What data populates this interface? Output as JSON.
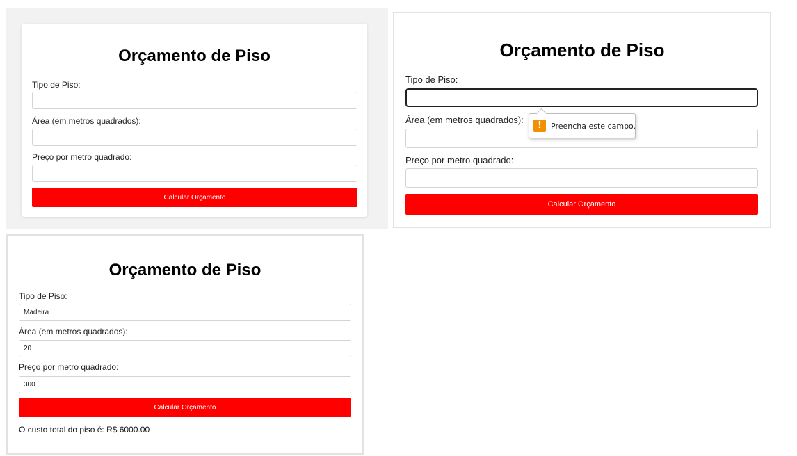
{
  "screens": {
    "initial": {
      "title": "Orçamento de Piso",
      "tipo_label": "Tipo de Piso:",
      "area_label": "Área (em metros quadrados):",
      "preco_label": "Preço por metro quadrado:",
      "tipo_value": "",
      "area_value": "",
      "preco_value": "",
      "button_label": "Calcular Orçamento"
    },
    "validation": {
      "title": "Orçamento de Piso",
      "tipo_label": "Tipo de Piso:",
      "area_label": "Área (em metros quadrados):",
      "preco_label": "Preço por metro quadrado:",
      "tipo_value": "",
      "area_value": "",
      "preco_value": "",
      "button_label": "Calcular Orçamento",
      "tooltip_icon": "warning-icon",
      "tooltip_icon_glyph": "!",
      "tooltip_text": "Preencha este campo."
    },
    "result": {
      "title": "Orçamento de Piso",
      "tipo_label": "Tipo de Piso:",
      "area_label": "Área (em metros quadrados):",
      "preco_label": "Preço por metro quadrado:",
      "tipo_value": "Madeira",
      "area_value": "20",
      "preco_value": "300",
      "button_label": "Calcular Orçamento",
      "result_text": "O custo total do piso é: R$ 6000.00"
    }
  },
  "colors": {
    "button_bg": "#ff0000",
    "button_text": "#ffffff",
    "warning": "#f29100",
    "focus_border": "#222222"
  }
}
